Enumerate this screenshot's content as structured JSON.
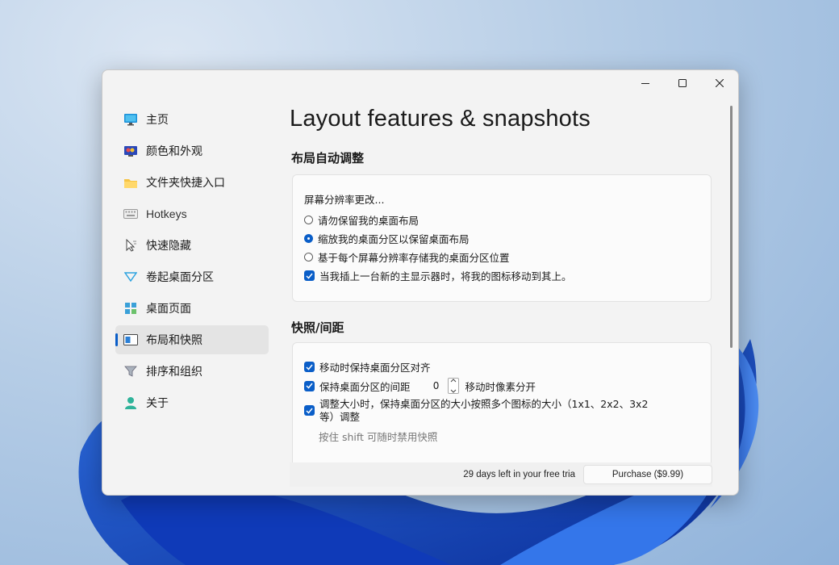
{
  "window": {
    "controls": {
      "minimize": "minimize-icon",
      "maximize": "maximize-icon",
      "close": "close-icon"
    }
  },
  "sidebar": {
    "items": [
      {
        "label": "主页",
        "icon": "monitor-icon"
      },
      {
        "label": "颜色和外观",
        "icon": "paint-monitor-icon"
      },
      {
        "label": "文件夹快捷入口",
        "icon": "folder-icon"
      },
      {
        "label": "Hotkeys",
        "icon": "keyboard-icon"
      },
      {
        "label": "快速隐藏",
        "icon": "cursor-hide-icon"
      },
      {
        "label": "卷起桌面分区",
        "icon": "rollup-triangle-icon"
      },
      {
        "label": "桌面页面",
        "icon": "pages-icon"
      },
      {
        "label": "布局和快照",
        "icon": "layout-icon",
        "active": true
      },
      {
        "label": "排序和组织",
        "icon": "filter-icon"
      },
      {
        "label": "关于",
        "icon": "person-icon"
      }
    ]
  },
  "main": {
    "title": "Layout features & snapshots",
    "auto_layout": {
      "heading": "布局自动调整",
      "prompt": "屏幕分辨率更改...",
      "options": [
        {
          "label": "请勿保留我的桌面布局",
          "checked": false
        },
        {
          "label": "缩放我的桌面分区以保留桌面布局",
          "checked": true
        },
        {
          "label": "基于每个屏幕分辨率存储我的桌面分区位置",
          "checked": false
        }
      ],
      "move_icons": {
        "label": "当我插上一台新的主显示器时，将我的图标移动到其上。",
        "checked": true
      }
    },
    "snap": {
      "heading": "快照/间距",
      "keep_aligned": {
        "label": "移动时保持桌面分区对齐",
        "checked": true
      },
      "spacing": {
        "label": "保持桌面分区的间距",
        "value": "0",
        "suffix": "移动时像素分开",
        "checked": true
      },
      "resize": {
        "line1": "调整大小时，保持桌面分区的大小按照多个图标的大小（1x1、2x2、3x2",
        "line2": "等）调整",
        "checked": true
      },
      "hint": "按住 shift 可随时禁用快照"
    }
  },
  "footer": {
    "trial_text": "29 days left in your free tria",
    "purchase_label": "Purchase ($9.99)"
  },
  "colors": {
    "accent": "#0a5ec8"
  }
}
